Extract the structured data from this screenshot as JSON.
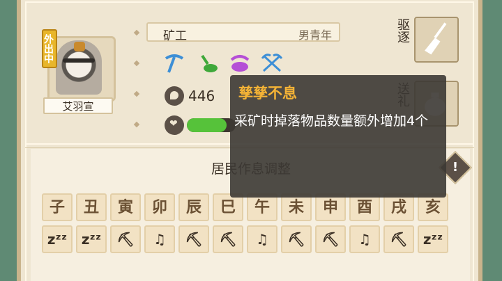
{
  "character": {
    "name": "艾羽宣",
    "status_badge": "外出中",
    "job": "矿工",
    "gender_age": "男青年",
    "coins": "446",
    "mood_fill": 0.82
  },
  "traits": [
    {
      "icon": "pickaxe-blue-icon",
      "color": "#3d8fd6"
    },
    {
      "icon": "shovel-green-icon",
      "color": "#3fa83a"
    },
    {
      "icon": "pickaxe-purple-icon",
      "color": "#b54fd6"
    },
    {
      "icon": "crossed-pickaxes-blue-icon",
      "color": "#3d8fd6"
    }
  ],
  "actions": {
    "expel": "驱逐",
    "gift": "送礼"
  },
  "tooltip": {
    "title": "孳孳不息",
    "description": "采矿时掉落物品数量额外增加4个"
  },
  "schedule": {
    "title": "居民作息调整",
    "hours": [
      "子",
      "丑",
      "寅",
      "卯",
      "辰",
      "巳",
      "午",
      "未",
      "申",
      "酉",
      "戌",
      "亥"
    ],
    "activities": [
      {
        "icon": "sleep-icon",
        "glyph": "zᶻᶻ"
      },
      {
        "icon": "sleep-icon",
        "glyph": "zᶻᶻ"
      },
      {
        "icon": "work-pickaxe-icon",
        "glyph": "⛏"
      },
      {
        "icon": "leisure-music-icon",
        "glyph": "♫"
      },
      {
        "icon": "work-pickaxe-icon",
        "glyph": "⛏"
      },
      {
        "icon": "work-pickaxe-icon",
        "glyph": "⛏"
      },
      {
        "icon": "leisure-music-icon",
        "glyph": "♫"
      },
      {
        "icon": "work-pickaxe-icon",
        "glyph": "⛏"
      },
      {
        "icon": "work-pickaxe-icon",
        "glyph": "⛏"
      },
      {
        "icon": "leisure-music-icon",
        "glyph": "♫"
      },
      {
        "icon": "work-pickaxe-icon",
        "glyph": "⛏"
      },
      {
        "icon": "sleep-icon",
        "glyph": "zᶻᶻ"
      }
    ]
  }
}
